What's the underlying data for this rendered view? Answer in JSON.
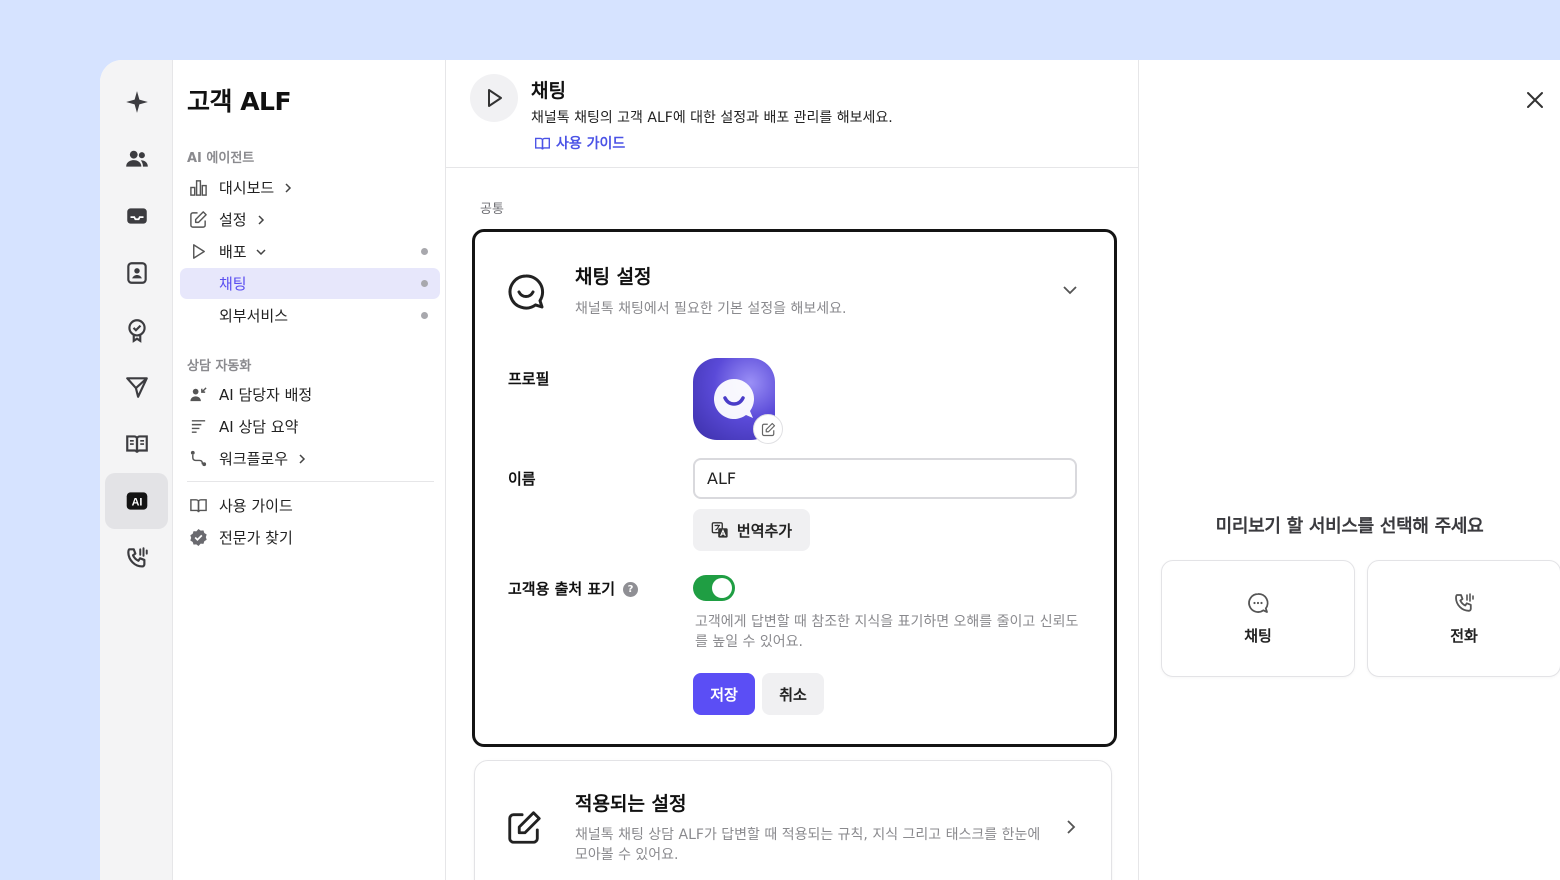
{
  "nav": {
    "title": "고객 ALF",
    "section_agent": "AI 에이전트",
    "section_automation": "상담 자동화",
    "items": {
      "dashboard": "대시보드",
      "settings": "설정",
      "deploy": "배포",
      "chatting": "채팅",
      "external": "외부서비스",
      "ai_assign": "AI 담당자 배정",
      "ai_summary": "AI 상담 요약",
      "workflow": "워크플로우",
      "guide": "사용 가이드",
      "expert": "전문가 찾기"
    },
    "rail_active": "AI"
  },
  "header": {
    "title": "채팅",
    "description": "채널톡 채팅의 고객 ALF에 대한 설정과 배포 관리를 해보세요.",
    "guide_link": "사용 가이드"
  },
  "main": {
    "section_label": "공통",
    "chat_settings": {
      "title": "채팅 설정",
      "description": "채널톡 채팅에서 필요한 기본 설정을 해보세요.",
      "profile_label": "프로필",
      "name_label": "이름",
      "name_value": "ALF",
      "translate_button": "번역추가",
      "source_label": "고객용 출처 표기",
      "source_help": "?",
      "source_enabled": true,
      "source_description": "고객에게 답변할 때 참조한 지식을 표기하면 오해를 줄이고 신뢰도를 높일 수 있어요.",
      "save_button": "저장",
      "cancel_button": "취소"
    },
    "applied_settings": {
      "title": "적용되는 설정",
      "description": "채널톡 채팅 상담 ALF가 답변할 때 적용되는 규칙, 지식 그리고 태스크를 한눈에 모아볼 수 있어요."
    }
  },
  "preview": {
    "title": "미리보기 할 서비스를 선택해 주세요",
    "services": [
      "채팅",
      "전화"
    ]
  },
  "colors": {
    "accent": "#5b4ef5",
    "toggle_on": "#1f9e43",
    "link": "#4b53e6",
    "background": "#d6e3ff"
  }
}
